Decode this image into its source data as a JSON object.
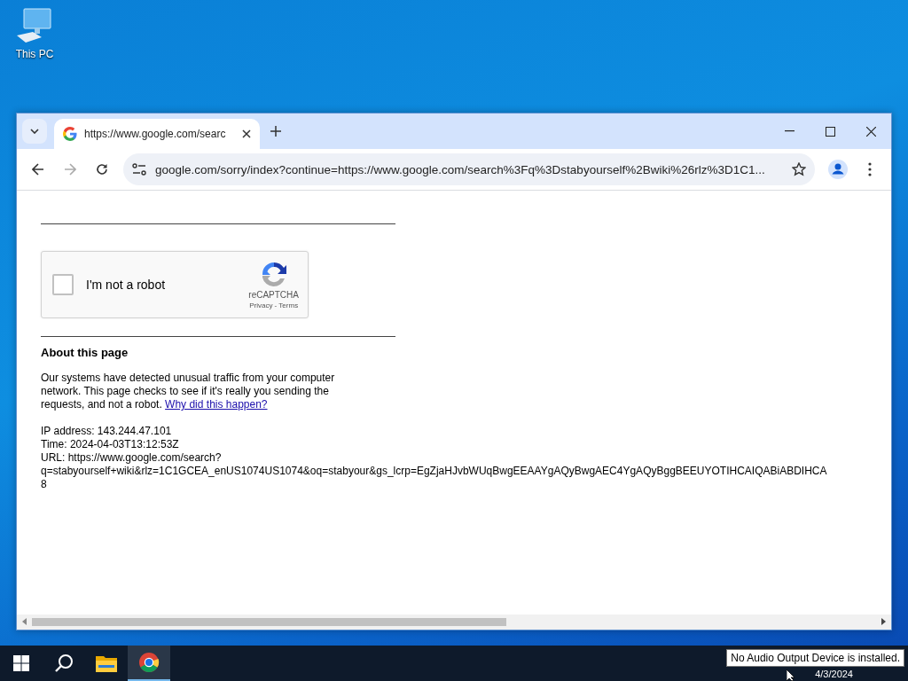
{
  "desktop": {
    "icons": [
      {
        "label": "This PC"
      }
    ]
  },
  "browser": {
    "tabs": [
      {
        "title": "https://www.google.com/searc",
        "selected": true
      }
    ],
    "address": "google.com/sorry/index?continue=https://www.google.com/search%3Fq%3Dstabyourself%2Bwiki%26rlz%3D1C1...",
    "page": {
      "captcha": {
        "label": "I'm not a robot",
        "checked": false,
        "brand": "reCAPTCHA",
        "links": "Privacy - Terms"
      },
      "heading": "About this page",
      "message": "Our systems have detected unusual traffic from your computer network. This page checks to see if it's really you sending the requests, and not a robot.",
      "link": "Why did this happen?",
      "details": [
        "IP address: 143.244.47.101",
        "Time: 2024-04-03T13:12:53Z",
        "URL: https://www.google.com/search?",
        "q=stabyourself+wiki&rlz=1C1GCEA_enUS1074US1074&oq=stabyour&gs_lcrp=EgZjaHJvbWUqBwgEEAAYgAQyBwgAEC4YgAQyBggBEEUYOTIHCAIQABiABDIHCA",
        "8"
      ]
    }
  },
  "taskbar": {
    "apps": [
      {
        "kind": "start",
        "selected": false
      },
      {
        "kind": "search",
        "selected": false
      },
      {
        "kind": "files",
        "selected": false
      },
      {
        "kind": "chrome",
        "selected": true
      }
    ],
    "date": "4/3/2024",
    "tooltip": "No Audio Output Device is installed."
  }
}
